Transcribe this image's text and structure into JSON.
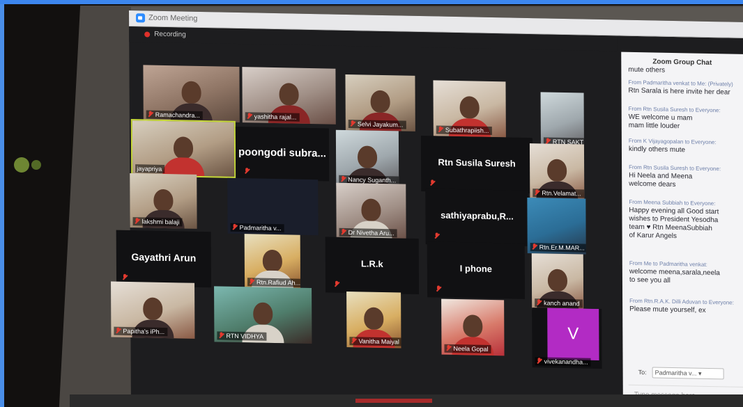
{
  "window": {
    "title": "Zoom Meeting"
  },
  "recording": {
    "label": "Recording"
  },
  "participants": [
    {
      "name": "Ramachandra...",
      "kind": "video",
      "muted": true
    },
    {
      "name": "yashitha rajal...",
      "kind": "video",
      "muted": true
    },
    {
      "name": "Selvi Jayakum...",
      "kind": "video",
      "muted": true
    },
    {
      "name": "Subathrapiish...",
      "kind": "video",
      "muted": true
    },
    {
      "name": "RTN SAKTHI A...",
      "kind": "video",
      "muted": true
    },
    {
      "name": "jayapriya",
      "kind": "video",
      "muted": false,
      "active_speaker": true
    },
    {
      "name": "poongodi  subra...",
      "kind": "name",
      "muted": true
    },
    {
      "name": "Nancy Suganth...",
      "kind": "video",
      "muted": true
    },
    {
      "name": "Rtn Susila Suresh",
      "kind": "name",
      "muted": true
    },
    {
      "name": "Rtn.Velamat...",
      "kind": "video",
      "muted": true
    },
    {
      "name": "lakshmi balaji",
      "kind": "video",
      "muted": true
    },
    {
      "name": "Padmaritha v...",
      "kind": "video",
      "muted": true
    },
    {
      "name": "Dr Nivetha Aru...",
      "kind": "video",
      "muted": true
    },
    {
      "name": "sathiyaprabu,R...",
      "kind": "name",
      "muted": true
    },
    {
      "name": "Rtn.Er.M.MAR...",
      "kind": "video",
      "muted": true
    },
    {
      "name": "Gayathri Arun",
      "kind": "name",
      "muted": true
    },
    {
      "name": "Rtn.Rafiud Ah...",
      "kind": "video",
      "muted": true
    },
    {
      "name": "L.R.k",
      "kind": "name",
      "muted": true
    },
    {
      "name": "I phone",
      "kind": "name",
      "muted": true
    },
    {
      "name": "kanch anand",
      "kind": "video",
      "muted": true
    },
    {
      "name": "Papitha's iPh...",
      "kind": "video",
      "muted": true
    },
    {
      "name": "RTN VIDHYA",
      "kind": "video",
      "muted": true
    },
    {
      "name": "Vanitha Maiyal",
      "kind": "video",
      "muted": true
    },
    {
      "name": "Neela Gopal",
      "kind": "video",
      "muted": true
    },
    {
      "name": "vivekanandha...",
      "kind": "avatar",
      "avatar_letter": "V",
      "muted": true
    }
  ],
  "chat": {
    "title": "Zoom Group Chat",
    "messages": [
      {
        "from": "",
        "text": "mute others"
      },
      {
        "from": "From Padmaritha venkat to Me: (Privately)",
        "text": "Rtn Sarala is here invite her dear"
      },
      {
        "from": "From Rtn Susila Suresh to Everyone:",
        "text": "WE welcome u mam\nmam little louder"
      },
      {
        "from": "From K Vijayagopalan to Everyone:",
        "text": "kindly others mute"
      },
      {
        "from": "From Rtn Susila Suresh to Everyone:",
        "text": "Hi Neela and Meena\nwelcome dears"
      },
      {
        "from": "From Meena Subbiah to Everyone:",
        "text": "Happy evening all Good start\nwishes to President Yesodha\nteam ♥ Rtn MeenaSubbiah\nof Karur Angels"
      },
      {
        "from": "From Me to Padmaritha venkat:",
        "text": "welcome meena,sarala,neela\nto see you all"
      },
      {
        "from": "From Rtn.R.A.K. Dilli Aduvan to Everyone:",
        "text": "Please mute yourself, ex"
      }
    ],
    "to_label": "To:",
    "to_value": "Padmaritha v...",
    "input_placeholder": "Type message here..."
  },
  "colors": {
    "accent_active": "#c7d93a",
    "muted_icon": "#e23a2f",
    "avatar_purple": "#b22bc4"
  }
}
